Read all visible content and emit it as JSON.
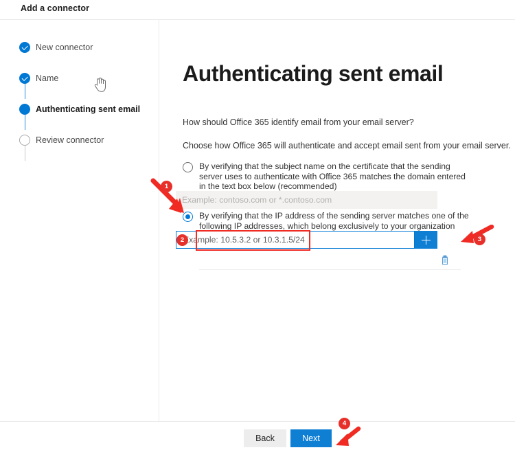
{
  "header": {
    "title": "Add a connector"
  },
  "sidebar": {
    "steps": [
      {
        "label": "New connector",
        "state": "done",
        "icon": "check-circle-icon"
      },
      {
        "label": "Name",
        "state": "done",
        "icon": "check-circle-icon"
      },
      {
        "label": "Authenticating sent email",
        "state": "current",
        "icon": "filled-circle-icon"
      },
      {
        "label": "Review connector",
        "state": "todo",
        "icon": "empty-circle-icon"
      }
    ]
  },
  "main": {
    "page_title": "Authenticating sent email",
    "intro_line_1": "How should Office 365 identify email from your email server?",
    "intro_line_2": "Choose how Office 365 will authenticate and accept email sent from your email server.",
    "options": [
      {
        "id": "certificate",
        "selected": false,
        "label": "By verifying that the subject name on the certificate that the sending server uses to authenticate with Office 365 matches the domain entered in the text box below (recommended)",
        "field": {
          "placeholder": "Example: contoso.com or *.contoso.com",
          "value": "",
          "disabled": true
        }
      },
      {
        "id": "ip-address",
        "selected": true,
        "label": "By verifying that the IP address of the sending server matches one of the following IP addresses, which belong exclusively to your organization",
        "field": {
          "placeholder": "Example: 10.5.3.2 or 10.3.1.5/24",
          "value": "",
          "disabled": false,
          "focused": true
        },
        "add_button_icon": "plus-icon",
        "delete_button_icon": "trash-icon"
      }
    ]
  },
  "footer": {
    "back_label": "Back",
    "next_label": "Next"
  },
  "annotations": {
    "markers": [
      {
        "number": "1",
        "target": "ip-address-radio"
      },
      {
        "number": "2",
        "target": "ip-address-input"
      },
      {
        "number": "3",
        "target": "add-ip-button"
      },
      {
        "number": "4",
        "target": "next-button"
      }
    ],
    "highlight_color": "#ef2b24"
  },
  "colors": {
    "accent": "#0078d4",
    "primary_button": "#0f7fd4",
    "annotation_red": "#e8302a",
    "disabled_field": "#f3f2f1"
  }
}
